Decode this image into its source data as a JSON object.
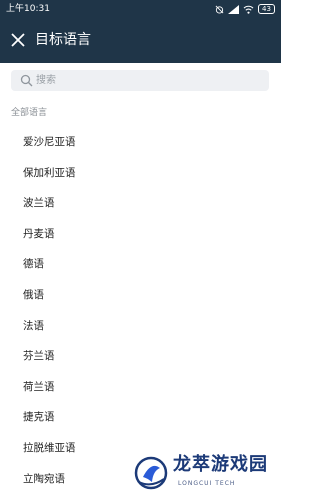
{
  "status_bar": {
    "time": "上午10:31",
    "battery": "43",
    "icons": [
      "alarm-off-icon",
      "signal-icon",
      "wifi-icon",
      "battery-icon"
    ]
  },
  "header": {
    "title": "目标语言",
    "close_icon": "close-icon",
    "background_color": "#1f3548"
  },
  "search": {
    "placeholder": "搜索",
    "value": ""
  },
  "section": {
    "label": "全部语言"
  },
  "languages": [
    "爱沙尼亚语",
    "保加利亚语",
    "波兰语",
    "丹麦语",
    "德语",
    "俄语",
    "法语",
    "芬兰语",
    "荷兰语",
    "捷克语",
    "拉脱维亚语",
    "立陶宛语"
  ],
  "watermark": {
    "title": "龙萃游戏园",
    "subtitle": "LONGCUI TECH"
  }
}
